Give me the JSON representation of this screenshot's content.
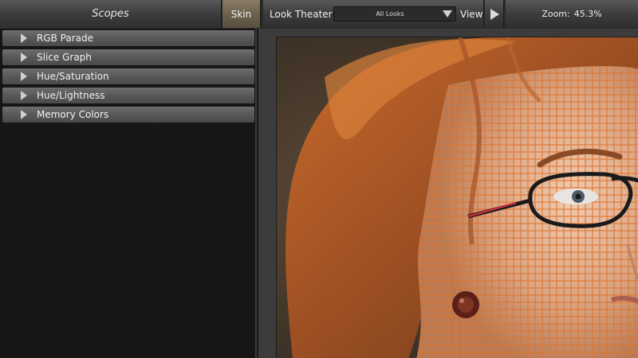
{
  "header": {
    "scopes_title": "Scopes",
    "skin_label": "Skin",
    "look_theater_label": "Look Theater",
    "look_select_value": "All Looks",
    "view_label": "View",
    "zoom_label": "Zoom:",
    "zoom_value": "45.3%"
  },
  "scopes": {
    "items": [
      {
        "label": "RGB Parade"
      },
      {
        "label": "Slice Graph"
      },
      {
        "label": "Hue/Saturation"
      },
      {
        "label": "Hue/Lightness"
      },
      {
        "label": "Memory Colors"
      }
    ]
  },
  "viewer": {
    "image_icon": "portrait-woman-glasses",
    "overlay_color": "#e0742e"
  }
}
